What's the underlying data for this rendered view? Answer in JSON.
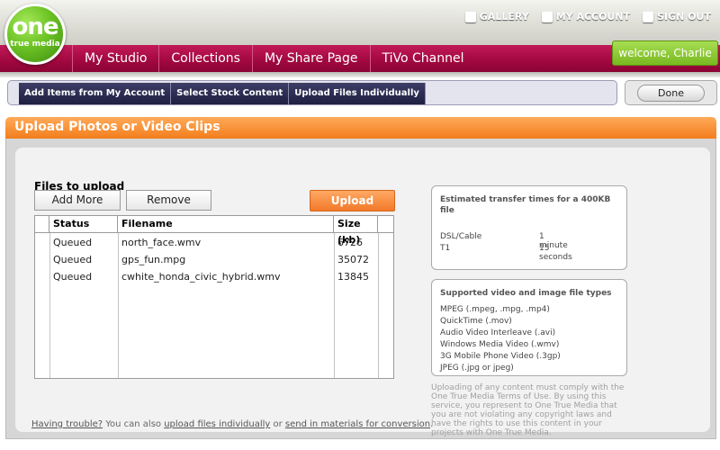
{
  "brand": {
    "logo_main": "one",
    "logo_sub": "true media"
  },
  "header": {
    "top_links": [
      "GALLERY",
      "MY ACCOUNT",
      "SIGN OUT"
    ],
    "nav_tabs": [
      "My Studio",
      "Collections",
      "My Share Page",
      "TiVo Channel"
    ],
    "welcome": "welcome, Charlie"
  },
  "toolbar": {
    "tabs": [
      "Add Items from My Account",
      "Select Stock Content",
      "Upload Files Individually"
    ],
    "done_label": "Done"
  },
  "panel": {
    "title": "Upload Photos or Video Clips",
    "files_label": "Files to upload",
    "add_more": "Add More",
    "remove": "Remove",
    "upload": "Upload",
    "table": {
      "headers": [
        "Status",
        "Filename",
        "Size (kb)"
      ],
      "rows": [
        {
          "status": "Queued",
          "filename": "north_face.wmv",
          "size": "6726"
        },
        {
          "status": "Queued",
          "filename": "gps_fun.mpg",
          "size": "35072"
        },
        {
          "status": "Queued",
          "filename": "cwhite_honda_civic_hybrid.wmv",
          "size": "13845"
        }
      ]
    },
    "trouble": {
      "link1": "Having trouble?",
      "text1": " You can also ",
      "link2": "upload files individually",
      "text2": " or ",
      "link3": "send in materials for conversion",
      "text3": "."
    }
  },
  "transfer_times": {
    "title": "Estimated transfer times for a 400KB file",
    "rows": [
      {
        "type": "DSL/Cable",
        "time": "1 minute"
      },
      {
        "type": "T1",
        "time": "15 seconds"
      }
    ]
  },
  "file_types": {
    "title": "Supported video and image file types",
    "items": [
      "MPEG (.mpeg, .mpg, .mp4)",
      "QuickTime (.mov)",
      "Audio Video Interleave (.avi)",
      "Windows Media Video (.wmv)",
      "3G Mobile Phone Video (.3gp)",
      "JPEG (.jpg or jpeg)"
    ]
  },
  "terms": "Uploading of any content must comply with the One True Media Terms of Use. By using this service, you represent to One True Media that you are not violating any copyright laws and have the rights to use this content in your projects with One True Media."
}
